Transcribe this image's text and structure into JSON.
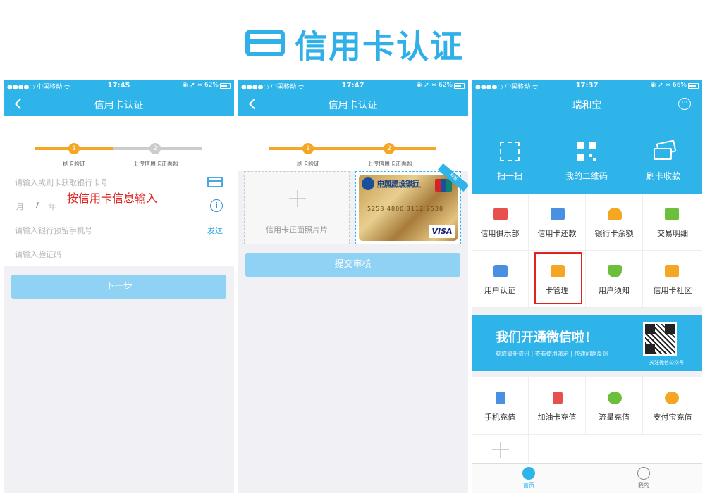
{
  "banner": {
    "title": "信用卡认证"
  },
  "colors": {
    "primary": "#2fb4ea",
    "step_active": "#f5a623",
    "step_inactive": "#cccccc",
    "highlight": "#e0231e"
  },
  "phone1": {
    "status": {
      "left": "●●●●○ 中国移动 ᯤ",
      "time": "17:45",
      "right": "◉ ➚ ∗ 62%"
    },
    "nav_title": "信用卡认证",
    "steps": [
      {
        "num": "1",
        "label": "刷卡验证"
      },
      {
        "num": "2",
        "label": "上传信用卡正面照"
      }
    ],
    "fields": {
      "card_placeholder": "请输入或刷卡获取银行卡号",
      "month": "月",
      "slash": "/",
      "year": "年",
      "phone_placeholder": "请输入银行预留手机号",
      "send_label": "发送",
      "code_placeholder": "请输入验证码"
    },
    "red_note": "按信用卡信息输入",
    "next_button": "下一步"
  },
  "phone2": {
    "status": {
      "left": "●●●●○ 中国移动 ᯤ",
      "time": "17:47",
      "right": "◉ ➚ ∗ 62%"
    },
    "nav_title": "信用卡认证",
    "steps": [
      {
        "num": "1",
        "label": "刷卡验证"
      },
      {
        "num": "2",
        "label": "上传信用卡正面照"
      }
    ],
    "photo_label": "信用卡正面照片片",
    "card": {
      "bank_name": "中国建设银行",
      "bank_en": "China Construction Bank",
      "number": "5258 4800 3112 2538",
      "brand": "VISA",
      "tag": "样张"
    },
    "submit_button": "提交审核"
  },
  "phone3": {
    "status": {
      "left": "●●●●○ 中国移动 ᯤ",
      "time": "17:37",
      "right": "◉ ➚ ∗ 66%"
    },
    "nav_title": "瑞和宝",
    "quick_actions": [
      {
        "label": "扫一扫",
        "icon": "scan-icon"
      },
      {
        "label": "我的二维码",
        "icon": "qr-code-icon"
      },
      {
        "label": "刷卡收款",
        "icon": "card-payment-icon"
      }
    ],
    "grid1": [
      {
        "label": "信用俱乐部",
        "icon": "club-icon",
        "color": "#e8504f"
      },
      {
        "label": "信用卡还款",
        "icon": "wallet-icon",
        "color": "#4a90e2"
      },
      {
        "label": "银行卡余额",
        "icon": "money-bag-icon",
        "color": "#f5a623"
      },
      {
        "label": "交易明细",
        "icon": "transaction-icon",
        "color": "#6cbf3b"
      },
      {
        "label": "用户认证",
        "icon": "user-card-icon",
        "color": "#4a90e2"
      },
      {
        "label": "卡管理",
        "icon": "card-manage-icon",
        "color": "#f5a623"
      },
      {
        "label": "用户须知",
        "icon": "shield-icon",
        "color": "#6cbf3b"
      },
      {
        "label": "信用卡社区",
        "icon": "community-icon",
        "color": "#f5a623"
      }
    ],
    "wechat": {
      "title": "我们开通微信啦！",
      "subtitle": "获取最新资讯 | 查看使用演示 | 快速问题反馈",
      "qr_label": "关注微信公众号"
    },
    "grid2": [
      {
        "label": "手机充值",
        "icon": "phone-topup-icon",
        "color": "#4a90e2"
      },
      {
        "label": "加油卡充值",
        "icon": "fuel-icon",
        "color": "#e8504f"
      },
      {
        "label": "流量充值",
        "icon": "data-icon",
        "color": "#6cbf3b"
      },
      {
        "label": "支付宝充值",
        "icon": "alipay-icon",
        "color": "#f5a623"
      }
    ],
    "tabs": [
      {
        "label": "首页"
      },
      {
        "label": "我的"
      }
    ]
  }
}
